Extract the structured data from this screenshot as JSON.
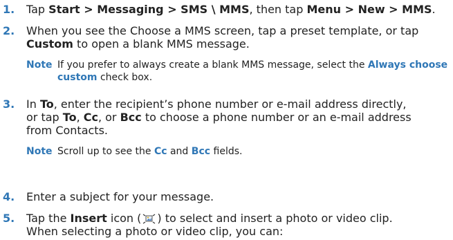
{
  "steps": [
    {
      "number": "1.",
      "t1": "Tap ",
      "b1": "Start > Messaging > SMS \\ MMS",
      "t2": ", then tap ",
      "b2": "Menu > New > MMS",
      "t3": "."
    },
    {
      "number": "2.",
      "t1": "When you see the Choose a MMS screen, tap a preset template, or tap",
      "b1": "Custom",
      "t2": " to open a blank MMS message.",
      "note": {
        "label": "Note",
        "t1": "If you prefer to always create a blank MMS message, select the ",
        "b1": "Always choose custom",
        "t2": " check box."
      }
    },
    {
      "number": "3.",
      "t1": "In ",
      "b1": "To",
      "t2": ", enter the recipient’s phone number or e-mail address directly,",
      "t3": "or tap ",
      "b2": "To",
      "t4": ", ",
      "b3": "Cc",
      "t5": ", or ",
      "b4": "Bcc",
      "t6": " to choose a phone number or an e-mail address",
      "t7": "from Contacts.",
      "note": {
        "label": "Note",
        "t1": "Scroll up to see the ",
        "b1": "Cc",
        "t2": " and ",
        "b2": "Bcc",
        "t3": " fields."
      }
    },
    {
      "number": "4.",
      "t1": "Enter a subject for your message."
    },
    {
      "number": "5.",
      "t1": "Tap the ",
      "b1": "Insert",
      "t2": " icon (",
      "icon": "insert-icon",
      "t3": ") to select and insert a photo or video clip.",
      "t4": "When selecting a photo or video clip, you can:"
    }
  ]
}
